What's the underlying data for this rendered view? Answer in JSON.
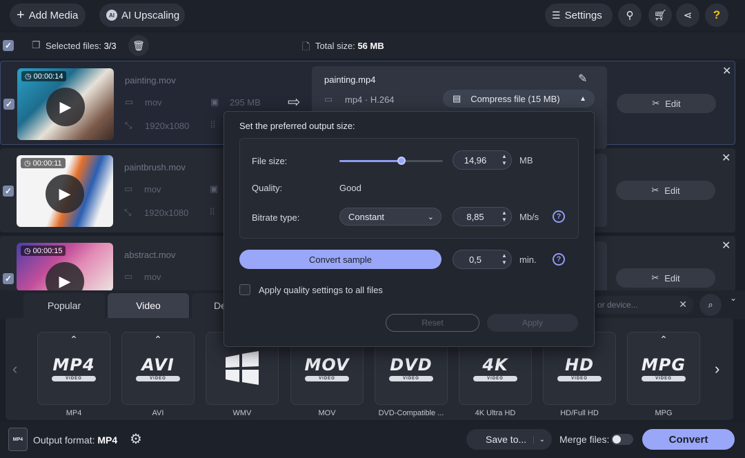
{
  "toolbar": {
    "add_media": "Add Media",
    "ai_upscaling": "AI Upscaling",
    "settings": "Settings"
  },
  "selection": {
    "selected_label": "Selected files:",
    "selected_count": "3/3",
    "total_label": "Total size:",
    "total_value": "56 MB"
  },
  "files": [
    {
      "duration": "00:00:14",
      "name": "painting.mov",
      "container": "mov",
      "size": "295 MB",
      "resolution": "1920x1080",
      "edit": "Edit"
    },
    {
      "duration": "00:00:11",
      "name": "paintbrush.mov",
      "container": "mov",
      "resolution": "1920x1080",
      "edit": "Edit"
    },
    {
      "duration": "00:00:15",
      "name": "abstract.mov",
      "container": "mov",
      "edit": "Edit"
    }
  ],
  "target": {
    "name": "painting.mp4",
    "codec": "mp4 · H.264",
    "compress": "Compress file (15 MB)"
  },
  "popup": {
    "title": "Set the preferred output size:",
    "file_size_label": "File size:",
    "file_size_value": "14,96",
    "file_size_unit": "MB",
    "file_size_fraction": 0.6,
    "quality_label": "Quality:",
    "quality_value": "Good",
    "bitrate_label": "Bitrate type:",
    "bitrate_value": "Constant",
    "bitrate_num": "8,85",
    "bitrate_unit": "Mb/s",
    "convert_sample": "Convert sample",
    "sample_value": "0,5",
    "sample_unit": "min.",
    "apply_all": "Apply quality settings to all files",
    "reset": "Reset",
    "apply": "Apply"
  },
  "tabs": {
    "popular": "Popular",
    "video": "Video",
    "partial": "De",
    "search_placeholder": "or device..."
  },
  "formats": [
    {
      "big": "MP4",
      "sub": "VIDEO",
      "label": "MP4"
    },
    {
      "big": "AVI",
      "sub": "VIDEO",
      "label": "AVI"
    },
    {
      "big": "",
      "sub": "",
      "label": "WMV"
    },
    {
      "big": "MOV",
      "sub": "VIDEO",
      "label": "MOV"
    },
    {
      "big": "DVD",
      "sub": "VIDEO",
      "label": "DVD-Compatible ..."
    },
    {
      "big": "4K",
      "sub": "VIDEO",
      "label": "4K Ultra HD"
    },
    {
      "big": "HD",
      "sub": "VIDEO",
      "label": "HD/Full HD"
    },
    {
      "big": "MPG",
      "sub": "VIDEO",
      "label": "MPG"
    }
  ],
  "bottom": {
    "output_label": "Output format:",
    "output_value": "MP4",
    "save_to": "Save to...",
    "merge": "Merge files:",
    "convert": "Convert"
  },
  "colors": {
    "accent": "#8f9cf4",
    "button": "#9aa6f7",
    "background": "#1b1f27"
  }
}
